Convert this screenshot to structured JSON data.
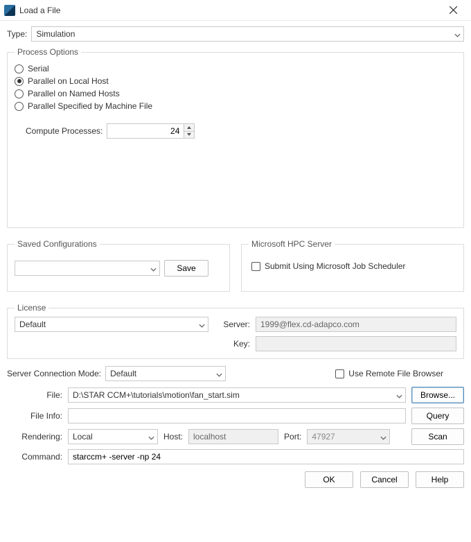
{
  "window": {
    "title": "Load a File"
  },
  "type_row": {
    "label": "Type:",
    "value": "Simulation"
  },
  "process_options": {
    "legend": "Process Options",
    "options": {
      "serial": {
        "label": "Serial",
        "selected": false
      },
      "local": {
        "label": "Parallel on Local Host",
        "selected": true
      },
      "named": {
        "label": "Parallel on Named Hosts",
        "selected": false
      },
      "machine": {
        "label": "Parallel Specified by Machine File",
        "selected": false
      }
    },
    "compute": {
      "label": "Compute Processes:",
      "value": "24"
    }
  },
  "saved_configs": {
    "legend": "Saved Configurations",
    "value": "",
    "save_label": "Save"
  },
  "hpc": {
    "legend": "Microsoft HPC Server",
    "checkbox_label": "Submit Using Microsoft Job Scheduler",
    "checked": false
  },
  "license": {
    "legend": "License",
    "value": "Default",
    "server_label": "Server:",
    "server_value": "1999@flex.cd-adapco.com",
    "key_label": "Key:",
    "key_value": ""
  },
  "scm": {
    "label": "Server Connection Mode:",
    "value": "Default",
    "remote_label": "Use Remote File Browser",
    "remote_checked": false
  },
  "file": {
    "label": "File:",
    "value": "D:\\STAR CCM+\\tutorials\\motion\\fan_start.sim",
    "browse_label": "Browse..."
  },
  "file_info": {
    "label": "File Info:",
    "value": "",
    "query_label": "Query"
  },
  "rendering": {
    "label": "Rendering:",
    "value": "Local",
    "host_label": "Host:",
    "host_value": "localhost",
    "port_label": "Port:",
    "port_value": "47927",
    "scan_label": "Scan"
  },
  "command": {
    "label": "Command:",
    "value": "starccm+ -server -np 24"
  },
  "footer": {
    "ok": "OK",
    "cancel": "Cancel",
    "help": "Help"
  }
}
